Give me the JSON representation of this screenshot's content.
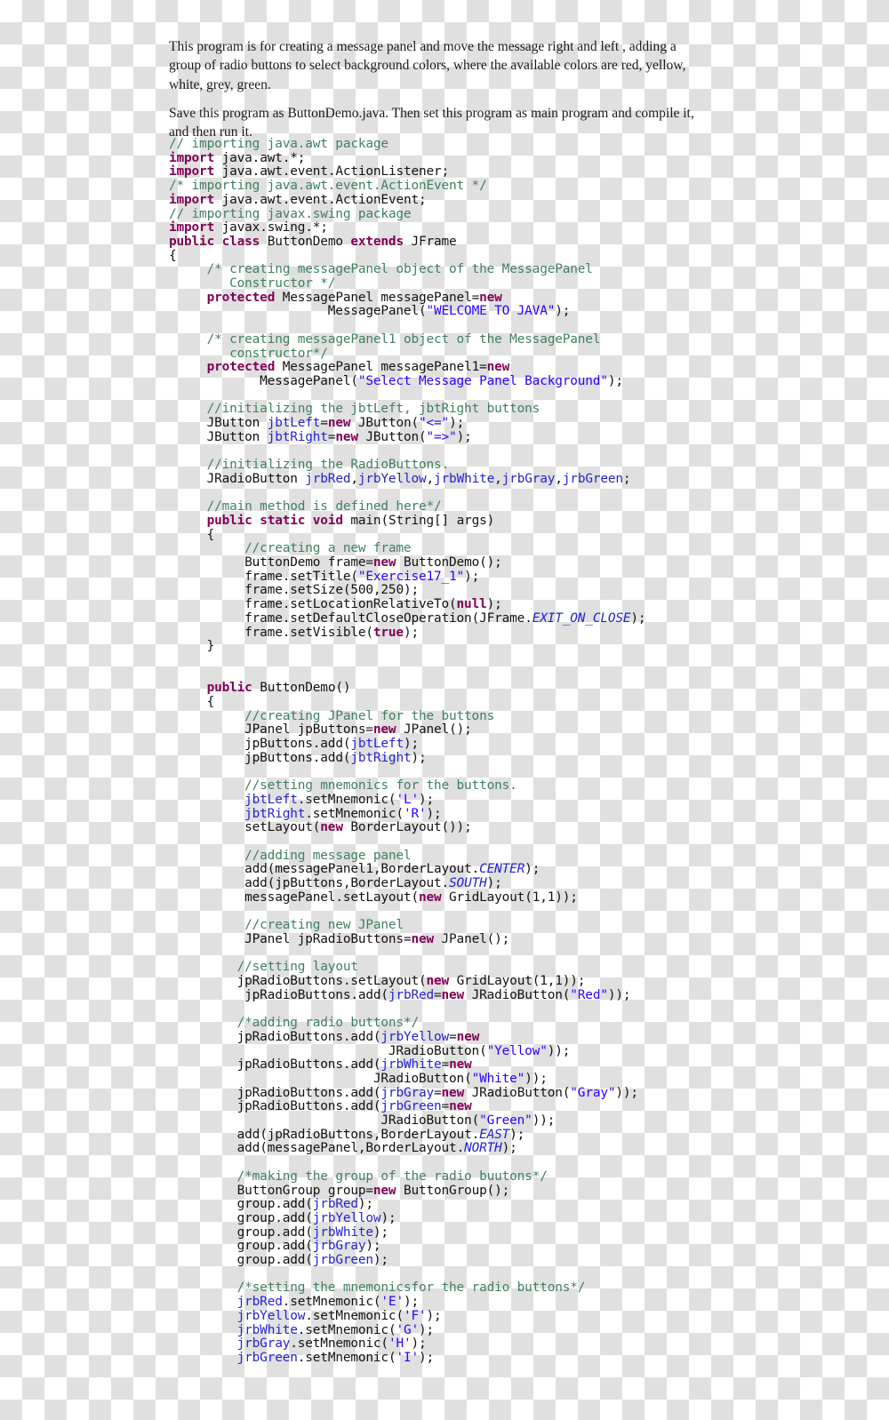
{
  "document": {
    "kind": "java-source-listing",
    "intro": {
      "paragraph_1": "This program is for creating a message panel and move the message right and left , adding a group of radio buttons to select background colors, where the available colors are red, yellow, white,  grey, green.",
      "paragraph_2": "Save this program as ButtonDemo.java. Then set this program as main program and compile it, and then run it."
    },
    "colors": {
      "comment": "#3f7f5f",
      "keyword": "#7f0055",
      "string": "#2a00ff",
      "identifier": "#2323cf",
      "plain": "#111111",
      "checker_light": "#ffffff",
      "checker_dark": "#e0e0e0"
    },
    "code": {
      "language": "Java",
      "file_name": "ButtonDemo.java",
      "lines": [
        "// importing java.awt package",
        "import java.awt.*;",
        "import java.awt.event.ActionListener;",
        "/* importing java.awt.event.ActionEvent */",
        "import java.awt.event.ActionEvent;",
        "// importing javax.swing package",
        "import javax.swing.*;",
        "public class ButtonDemo extends JFrame",
        "{",
        "     /* creating messagePanel object of the MessagePanel",
        "        Constructor */",
        "     protected MessagePanel messagePanel=new",
        "                     MessagePanel(\"WELCOME TO JAVA\");",
        "",
        "     /* creating messagePanel1 object of the MessagePanel",
        "        constructor*/",
        "     protected MessagePanel messagePanel1=new",
        "            MessagePanel(\"Select Message Panel Background\");",
        "",
        "     //initializing the jbtLeft, jbtRight buttons",
        "     JButton jbtLeft=new JButton(\"<=\");",
        "     JButton jbtRight=new JButton(\"=>\");",
        "",
        "     //initializing the RadioButtons.",
        "     JRadioButton jrbRed,jrbYellow,jrbWhite,jrbGray,jrbGreen;",
        "",
        "     //main method is defined here*/",
        "     public static void main(String[] args)",
        "     {",
        "          //creating a new frame",
        "          ButtonDemo frame=new ButtonDemo();",
        "          frame.setTitle(\"Exercise17_1\");",
        "          frame.setSize(500,250);",
        "          frame.setLocationRelativeTo(null);",
        "          frame.setDefaultCloseOperation(JFrame.EXIT_ON_CLOSE);",
        "          frame.setVisible(true);",
        "     }",
        "",
        "",
        "     public ButtonDemo()",
        "     {",
        "          //creating JPanel for the buttons",
        "          JPanel jpButtons=new JPanel();",
        "          jpButtons.add(jbtLeft);",
        "          jpButtons.add(jbtRight);",
        "",
        "          //setting mnemonics for the buttons.",
        "          jbtLeft.setMnemonic('L');",
        "          jbtRight.setMnemonic('R');",
        "          setLayout(new BorderLayout());",
        "",
        "          //adding message panel",
        "          add(messagePanel1,BorderLayout.CENTER);",
        "          add(jpButtons,BorderLayout.SOUTH);",
        "          messagePanel.setLayout(new GridLayout(1,1));",
        "",
        "          //creating new JPanel",
        "          JPanel jpRadioButtons=new JPanel();",
        "",
        "         //setting layout",
        "         jpRadioButtons.setLayout(new GridLayout(1,1));",
        "          jpRadioButtons.add(jrbRed=new JRadioButton(\"Red\"));",
        "",
        "         /*adding radio buttons*/",
        "         jpRadioButtons.add(jrbYellow=new",
        "                             JRadioButton(\"Yellow\"));",
        "         jpRadioButtons.add(jrbWhite=new",
        "                           JRadioButton(\"White\"));",
        "         jpRadioButtons.add(jrbGray=new JRadioButton(\"Gray\"));",
        "         jpRadioButtons.add(jrbGreen=new",
        "                            JRadioButton(\"Green\"));",
        "         add(jpRadioButtons,BorderLayout.EAST);",
        "         add(messagePanel,BorderLayout.NORTH);",
        "",
        "         /*making the group of the radio buutons*/",
        "         ButtonGroup group=new ButtonGroup();",
        "         group.add(jrbRed);",
        "         group.add(jrbYellow);",
        "         group.add(jrbWhite);",
        "         group.add(jrbGray);",
        "         group.add(jrbGreen);",
        "",
        "         /*setting the mnemonicsfor the radio buttons*/",
        "         jrbRed.setMnemonic('E');",
        "         jrbYellow.setMnemonic('F');",
        "         jrbWhite.setMnemonic('G');",
        "         jrbGray.setMnemonic('H');",
        "         jrbGreen.setMnemonic('I');"
      ]
    }
  }
}
